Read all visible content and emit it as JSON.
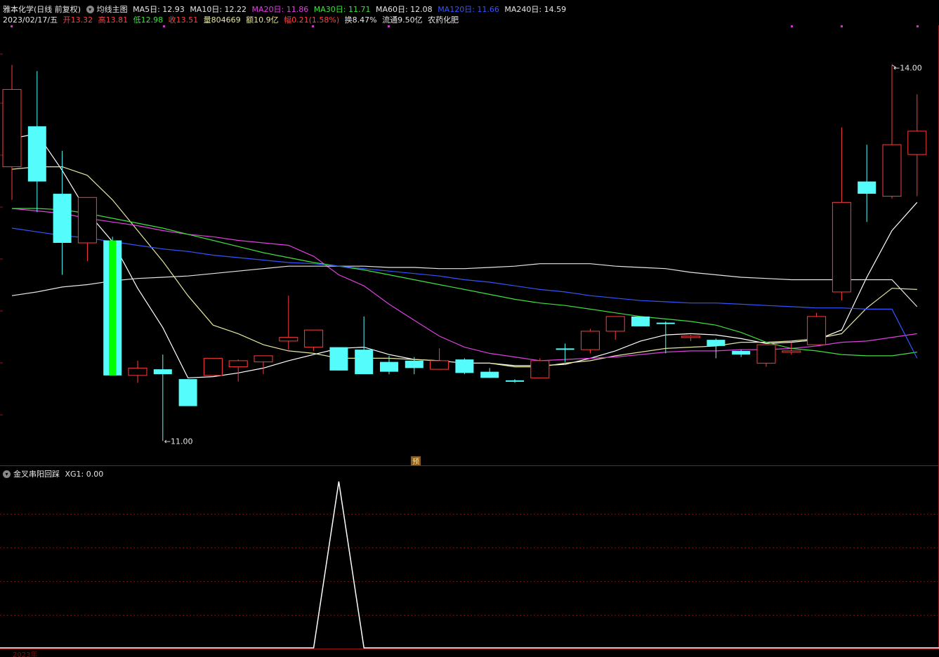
{
  "header": {
    "stock_name": "雅本化学(日线 前复权)",
    "indicator_name": "均线主图",
    "ma_labels": [
      {
        "label": "MA5日: 12.93",
        "color": "#e6e6e6"
      },
      {
        "label": "MA10日: 12.22",
        "color": "#e6e6a0"
      },
      {
        "label": "MA20日: 11.86",
        "color": "#e040e0"
      },
      {
        "label": "MA30日: 11.71",
        "color": "#40e040"
      },
      {
        "label": "MA60日: 12.08",
        "color": "#e6e6e6"
      },
      {
        "label": "MA120日: 11.66",
        "color": "#3355ff"
      },
      {
        "label": "MA240日: 14.59",
        "color": "#e6e6e6"
      }
    ],
    "date": "2023/02/17/五",
    "open_label": "开13.32",
    "high_label": "高13.81",
    "low_label": "低12.98",
    "close_label": "收13.51",
    "volume_label": "量804669",
    "amount_label": "额10.9亿",
    "change_label": "幅0.21(1.58%)",
    "turnover_label": "换8.47%",
    "float_label": "流通9.50亿",
    "sector_label": "农药化肥"
  },
  "sub_header": {
    "indicator": "金叉串阳回踩",
    "value_label": "XG1: 0.00"
  },
  "annotations": {
    "low_marker": "11.00",
    "high_marker": "14.00",
    "preview_badge": "预",
    "bottom_axis_label": "2023年"
  },
  "colors": {
    "up": "#ff3c3c",
    "down": "#54fcfc",
    "limit_down": "#00ff00",
    "ma5": "#ffffff",
    "ma10": "#e6e6a0",
    "ma20": "#e040e0",
    "ma30": "#40e040",
    "ma60": "#e6e6e6",
    "ma120": "#3355ff",
    "border": "#a01010"
  },
  "chart_data": [
    {
      "type": "candlestick",
      "ylim": [
        10.85,
        14.35
      ],
      "candles": [
        {
          "open": 13.22,
          "high": 14.05,
          "low": 12.95,
          "close": 13.85
        },
        {
          "open": 13.55,
          "high": 14.0,
          "low": 12.85,
          "close": 13.1
        },
        {
          "open": 13.0,
          "high": 13.35,
          "low": 12.34,
          "close": 12.6
        },
        {
          "open": 12.6,
          "high": 12.95,
          "low": 12.45,
          "close": 12.97
        },
        {
          "open": 12.62,
          "high": 12.65,
          "low": 11.52,
          "close": 11.52
        },
        {
          "open": 11.52,
          "high": 11.64,
          "low": 11.46,
          "close": 11.58
        },
        {
          "open": 11.57,
          "high": 11.69,
          "low": 11.02,
          "close": 11.53
        },
        {
          "open": 11.49,
          "high": 11.49,
          "low": 11.27,
          "close": 11.27
        },
        {
          "open": 11.52,
          "high": 11.62,
          "low": 11.52,
          "close": 11.66
        },
        {
          "open": 11.59,
          "high": 11.65,
          "low": 11.47,
          "close": 11.64
        },
        {
          "open": 11.63,
          "high": 11.68,
          "low": 11.53,
          "close": 11.68
        },
        {
          "open": 11.8,
          "high": 12.17,
          "low": 11.73,
          "close": 11.83
        },
        {
          "open": 11.75,
          "high": 11.85,
          "low": 11.72,
          "close": 11.89
        },
        {
          "open": 11.75,
          "high": 11.75,
          "low": 11.56,
          "close": 11.56
        },
        {
          "open": 11.73,
          "high": 12.0,
          "low": 11.53,
          "close": 11.53
        },
        {
          "open": 11.63,
          "high": 11.68,
          "low": 11.53,
          "close": 11.55
        },
        {
          "open": 11.64,
          "high": 11.67,
          "low": 11.53,
          "close": 11.58
        },
        {
          "open": 11.57,
          "high": 11.74,
          "low": 11.57,
          "close": 11.64
        },
        {
          "open": 11.65,
          "high": 11.66,
          "low": 11.53,
          "close": 11.54
        },
        {
          "open": 11.55,
          "high": 11.58,
          "low": 11.5,
          "close": 11.5
        },
        {
          "open": 11.48,
          "high": 11.49,
          "low": 11.46,
          "close": 11.47
        },
        {
          "open": 11.5,
          "high": 11.66,
          "low": 11.5,
          "close": 11.64
        },
        {
          "open": 11.74,
          "high": 11.78,
          "low": 11.63,
          "close": 11.73
        },
        {
          "open": 11.73,
          "high": 11.9,
          "low": 11.7,
          "close": 11.88
        },
        {
          "open": 11.88,
          "high": 12.0,
          "low": 11.81,
          "close": 12.0
        },
        {
          "open": 12.0,
          "high": 12.0,
          "low": 11.92,
          "close": 11.92
        },
        {
          "open": 11.95,
          "high": 11.96,
          "low": 11.7,
          "close": 11.94
        },
        {
          "open": 11.83,
          "high": 11.85,
          "low": 11.8,
          "close": 11.84
        },
        {
          "open": 11.81,
          "high": 11.82,
          "low": 11.66,
          "close": 11.76
        },
        {
          "open": 11.72,
          "high": 11.73,
          "low": 11.67,
          "close": 11.69
        },
        {
          "open": 11.62,
          "high": 11.77,
          "low": 11.59,
          "close": 11.77
        },
        {
          "open": 11.71,
          "high": 11.79,
          "low": 11.69,
          "close": 11.72
        },
        {
          "open": 11.77,
          "high": 12.03,
          "low": 11.77,
          "close": 12.0
        },
        {
          "open": 12.2,
          "high": 13.54,
          "low": 12.13,
          "close": 12.93
        },
        {
          "open": 13.1,
          "high": 13.4,
          "low": 12.77,
          "close": 13.0
        },
        {
          "open": 12.98,
          "high": 14.05,
          "low": 12.96,
          "close": 13.4
        },
        {
          "open": 13.32,
          "high": 13.81,
          "low": 12.98,
          "close": 13.51
        }
      ],
      "ma_series": [
        {
          "name": "MA5",
          "values": [
            13.45,
            13.49,
            13.19,
            12.85,
            12.61,
            12.23,
            11.91,
            11.5,
            11.51,
            11.54,
            11.58,
            11.64,
            11.69,
            11.74,
            11.75,
            11.69,
            11.65,
            11.64,
            11.62,
            11.62,
            11.6,
            11.6,
            11.61,
            11.66,
            11.72,
            11.8,
            11.85,
            11.86,
            11.85,
            11.82,
            11.78,
            11.79,
            11.81,
            11.89,
            12.32,
            12.7,
            12.93
          ]
        },
        {
          "name": "MA10",
          "values": [
            13.2,
            13.22,
            13.22,
            13.15,
            12.95,
            12.7,
            12.45,
            12.17,
            11.93,
            11.86,
            11.77,
            11.72,
            11.7,
            11.66,
            11.66,
            11.66,
            11.65,
            11.64,
            11.62,
            11.62,
            11.59,
            11.59,
            11.62,
            11.64,
            11.68,
            11.71,
            11.74,
            11.75,
            11.76,
            11.79,
            11.79,
            11.8,
            11.82,
            11.86,
            12.07,
            12.23,
            12.22
          ]
        },
        {
          "name": "MA20",
          "values": [
            12.88,
            12.86,
            12.84,
            12.8,
            12.77,
            12.74,
            12.7,
            12.67,
            12.65,
            12.62,
            12.6,
            12.58,
            12.49,
            12.34,
            12.25,
            12.1,
            11.97,
            11.84,
            11.75,
            11.7,
            11.67,
            11.64,
            11.65,
            11.66,
            11.67,
            11.69,
            11.71,
            11.72,
            11.72,
            11.73,
            11.73,
            11.74,
            11.76,
            11.79,
            11.8,
            11.83,
            11.86
          ]
        },
        {
          "name": "MA30",
          "values": [
            12.88,
            12.88,
            12.87,
            12.84,
            12.8,
            12.76,
            12.72,
            12.67,
            12.62,
            12.57,
            12.52,
            12.48,
            12.44,
            12.41,
            12.38,
            12.34,
            12.3,
            12.26,
            12.22,
            12.18,
            12.14,
            12.11,
            12.09,
            12.06,
            12.03,
            12.0,
            11.98,
            11.96,
            11.93,
            11.87,
            11.79,
            11.74,
            11.72,
            11.69,
            11.68,
            11.68,
            11.71
          ]
        },
        {
          "name": "MA60",
          "values": [
            12.17,
            12.2,
            12.24,
            12.26,
            12.29,
            12.31,
            12.32,
            12.33,
            12.35,
            12.37,
            12.39,
            12.41,
            12.41,
            12.41,
            12.41,
            12.4,
            12.4,
            12.39,
            12.39,
            12.4,
            12.41,
            12.43,
            12.43,
            12.43,
            12.41,
            12.4,
            12.39,
            12.36,
            12.34,
            12.32,
            12.31,
            12.3,
            12.3,
            12.3,
            12.3,
            12.3,
            12.08
          ]
        },
        {
          "name": "MA120",
          "values": [
            12.72,
            12.69,
            12.66,
            12.64,
            12.61,
            12.58,
            12.55,
            12.53,
            12.5,
            12.48,
            12.46,
            12.44,
            12.43,
            12.41,
            12.39,
            12.37,
            12.35,
            12.33,
            12.3,
            12.28,
            12.25,
            12.22,
            12.2,
            12.17,
            12.15,
            12.13,
            12.12,
            12.11,
            12.11,
            12.1,
            12.09,
            12.08,
            12.07,
            12.07,
            12.06,
            12.06,
            11.66
          ]
        },
        {
          "name": "MA240",
          "values": [
            null,
            null,
            null,
            null,
            null,
            null,
            null,
            null,
            null,
            null,
            null,
            null,
            null,
            null,
            null,
            null,
            null,
            null,
            null,
            null,
            null,
            null,
            null,
            null,
            null,
            null,
            null,
            null,
            null,
            null,
            null,
            null,
            null,
            null,
            null,
            null,
            14.59
          ]
        }
      ]
    },
    {
      "type": "line",
      "series": [
        {
          "name": "XG1",
          "values": [
            0,
            0,
            0,
            0,
            0,
            0,
            0,
            0,
            0,
            0,
            0,
            0,
            0,
            1,
            0,
            0,
            0,
            0,
            0,
            0,
            0,
            0,
            0,
            0,
            0,
            0,
            0,
            0,
            0,
            0,
            0,
            0,
            0,
            0,
            0,
            0,
            0
          ]
        }
      ],
      "ylim": [
        0,
        1
      ]
    }
  ]
}
